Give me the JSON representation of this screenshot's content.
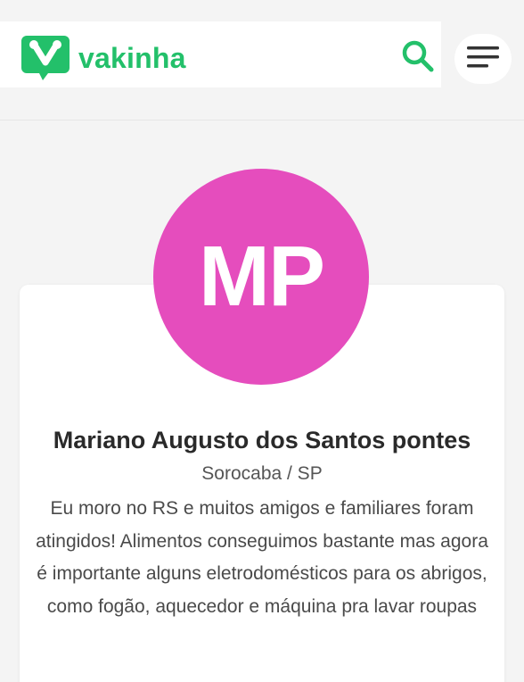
{
  "header": {
    "logo_text": "vakinha",
    "search_icon": "search-icon",
    "menu_icon": "hamburger-menu-icon"
  },
  "profile": {
    "initials": "MP",
    "name": "Mariano Augusto dos Santos pontes",
    "location": "Sorocaba / SP",
    "description": "Eu moro no RS e muitos amigos e familiares foram atingidos! Alimentos conseguimos bastante mas agora é importante alguns eletrodomésticos para os abrigos, como fogão, aquecedor e máquina pra lavar roupas"
  },
  "colors": {
    "brand": "#23c06a",
    "avatar": "#e54dbd"
  }
}
